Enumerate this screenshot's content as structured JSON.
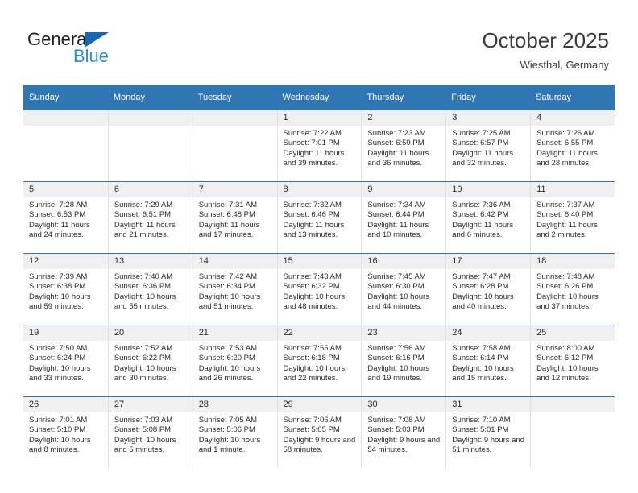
{
  "brand": {
    "name_part1": "General",
    "name_part2": "Blue",
    "triangle_color": "#1567b2",
    "blue_color": "#2a8fd4"
  },
  "header": {
    "title": "October 2025",
    "subtitle": "Wiesthal, Germany"
  },
  "theme": {
    "header_bar": "#3075b4",
    "daynum_band": "#f0f0f0",
    "text": "#2b2b2b"
  },
  "weekday_headers": [
    "Sunday",
    "Monday",
    "Tuesday",
    "Wednesday",
    "Thursday",
    "Friday",
    "Saturday"
  ],
  "weeks": [
    [
      {
        "day": "",
        "sunrise": "",
        "sunset": "",
        "daylight": "",
        "empty": true
      },
      {
        "day": "",
        "sunrise": "",
        "sunset": "",
        "daylight": "",
        "empty": true
      },
      {
        "day": "",
        "sunrise": "",
        "sunset": "",
        "daylight": "",
        "empty": true
      },
      {
        "day": "1",
        "sunrise": "Sunrise: 7:22 AM",
        "sunset": "Sunset: 7:01 PM",
        "daylight": "Daylight: 11 hours and 39 minutes.",
        "empty": false
      },
      {
        "day": "2",
        "sunrise": "Sunrise: 7:23 AM",
        "sunset": "Sunset: 6:59 PM",
        "daylight": "Daylight: 11 hours and 36 minutes.",
        "empty": false
      },
      {
        "day": "3",
        "sunrise": "Sunrise: 7:25 AM",
        "sunset": "Sunset: 6:57 PM",
        "daylight": "Daylight: 11 hours and 32 minutes.",
        "empty": false
      },
      {
        "day": "4",
        "sunrise": "Sunrise: 7:26 AM",
        "sunset": "Sunset: 6:55 PM",
        "daylight": "Daylight: 11 hours and 28 minutes.",
        "empty": false
      }
    ],
    [
      {
        "day": "5",
        "sunrise": "Sunrise: 7:28 AM",
        "sunset": "Sunset: 6:53 PM",
        "daylight": "Daylight: 11 hours and 24 minutes.",
        "empty": false
      },
      {
        "day": "6",
        "sunrise": "Sunrise: 7:29 AM",
        "sunset": "Sunset: 6:51 PM",
        "daylight": "Daylight: 11 hours and 21 minutes.",
        "empty": false
      },
      {
        "day": "7",
        "sunrise": "Sunrise: 7:31 AM",
        "sunset": "Sunset: 6:48 PM",
        "daylight": "Daylight: 11 hours and 17 minutes.",
        "empty": false
      },
      {
        "day": "8",
        "sunrise": "Sunrise: 7:32 AM",
        "sunset": "Sunset: 6:46 PM",
        "daylight": "Daylight: 11 hours and 13 minutes.",
        "empty": false
      },
      {
        "day": "9",
        "sunrise": "Sunrise: 7:34 AM",
        "sunset": "Sunset: 6:44 PM",
        "daylight": "Daylight: 11 hours and 10 minutes.",
        "empty": false
      },
      {
        "day": "10",
        "sunrise": "Sunrise: 7:36 AM",
        "sunset": "Sunset: 6:42 PM",
        "daylight": "Daylight: 11 hours and 6 minutes.",
        "empty": false
      },
      {
        "day": "11",
        "sunrise": "Sunrise: 7:37 AM",
        "sunset": "Sunset: 6:40 PM",
        "daylight": "Daylight: 11 hours and 2 minutes.",
        "empty": false
      }
    ],
    [
      {
        "day": "12",
        "sunrise": "Sunrise: 7:39 AM",
        "sunset": "Sunset: 6:38 PM",
        "daylight": "Daylight: 10 hours and 59 minutes.",
        "empty": false
      },
      {
        "day": "13",
        "sunrise": "Sunrise: 7:40 AM",
        "sunset": "Sunset: 6:36 PM",
        "daylight": "Daylight: 10 hours and 55 minutes.",
        "empty": false
      },
      {
        "day": "14",
        "sunrise": "Sunrise: 7:42 AM",
        "sunset": "Sunset: 6:34 PM",
        "daylight": "Daylight: 10 hours and 51 minutes.",
        "empty": false
      },
      {
        "day": "15",
        "sunrise": "Sunrise: 7:43 AM",
        "sunset": "Sunset: 6:32 PM",
        "daylight": "Daylight: 10 hours and 48 minutes.",
        "empty": false
      },
      {
        "day": "16",
        "sunrise": "Sunrise: 7:45 AM",
        "sunset": "Sunset: 6:30 PM",
        "daylight": "Daylight: 10 hours and 44 minutes.",
        "empty": false
      },
      {
        "day": "17",
        "sunrise": "Sunrise: 7:47 AM",
        "sunset": "Sunset: 6:28 PM",
        "daylight": "Daylight: 10 hours and 40 minutes.",
        "empty": false
      },
      {
        "day": "18",
        "sunrise": "Sunrise: 7:48 AM",
        "sunset": "Sunset: 6:26 PM",
        "daylight": "Daylight: 10 hours and 37 minutes.",
        "empty": false
      }
    ],
    [
      {
        "day": "19",
        "sunrise": "Sunrise: 7:50 AM",
        "sunset": "Sunset: 6:24 PM",
        "daylight": "Daylight: 10 hours and 33 minutes.",
        "empty": false
      },
      {
        "day": "20",
        "sunrise": "Sunrise: 7:52 AM",
        "sunset": "Sunset: 6:22 PM",
        "daylight": "Daylight: 10 hours and 30 minutes.",
        "empty": false
      },
      {
        "day": "21",
        "sunrise": "Sunrise: 7:53 AM",
        "sunset": "Sunset: 6:20 PM",
        "daylight": "Daylight: 10 hours and 26 minutes.",
        "empty": false
      },
      {
        "day": "22",
        "sunrise": "Sunrise: 7:55 AM",
        "sunset": "Sunset: 6:18 PM",
        "daylight": "Daylight: 10 hours and 22 minutes.",
        "empty": false
      },
      {
        "day": "23",
        "sunrise": "Sunrise: 7:56 AM",
        "sunset": "Sunset: 6:16 PM",
        "daylight": "Daylight: 10 hours and 19 minutes.",
        "empty": false
      },
      {
        "day": "24",
        "sunrise": "Sunrise: 7:58 AM",
        "sunset": "Sunset: 6:14 PM",
        "daylight": "Daylight: 10 hours and 15 minutes.",
        "empty": false
      },
      {
        "day": "25",
        "sunrise": "Sunrise: 8:00 AM",
        "sunset": "Sunset: 6:12 PM",
        "daylight": "Daylight: 10 hours and 12 minutes.",
        "empty": false
      }
    ],
    [
      {
        "day": "26",
        "sunrise": "Sunrise: 7:01 AM",
        "sunset": "Sunset: 5:10 PM",
        "daylight": "Daylight: 10 hours and 8 minutes.",
        "empty": false
      },
      {
        "day": "27",
        "sunrise": "Sunrise: 7:03 AM",
        "sunset": "Sunset: 5:08 PM",
        "daylight": "Daylight: 10 hours and 5 minutes.",
        "empty": false
      },
      {
        "day": "28",
        "sunrise": "Sunrise: 7:05 AM",
        "sunset": "Sunset: 5:06 PM",
        "daylight": "Daylight: 10 hours and 1 minute.",
        "empty": false
      },
      {
        "day": "29",
        "sunrise": "Sunrise: 7:06 AM",
        "sunset": "Sunset: 5:05 PM",
        "daylight": "Daylight: 9 hours and 58 minutes.",
        "empty": false
      },
      {
        "day": "30",
        "sunrise": "Sunrise: 7:08 AM",
        "sunset": "Sunset: 5:03 PM",
        "daylight": "Daylight: 9 hours and 54 minutes.",
        "empty": false
      },
      {
        "day": "31",
        "sunrise": "Sunrise: 7:10 AM",
        "sunset": "Sunset: 5:01 PM",
        "daylight": "Daylight: 9 hours and 51 minutes.",
        "empty": false
      },
      {
        "day": "",
        "sunrise": "",
        "sunset": "",
        "daylight": "",
        "empty": true
      }
    ]
  ]
}
